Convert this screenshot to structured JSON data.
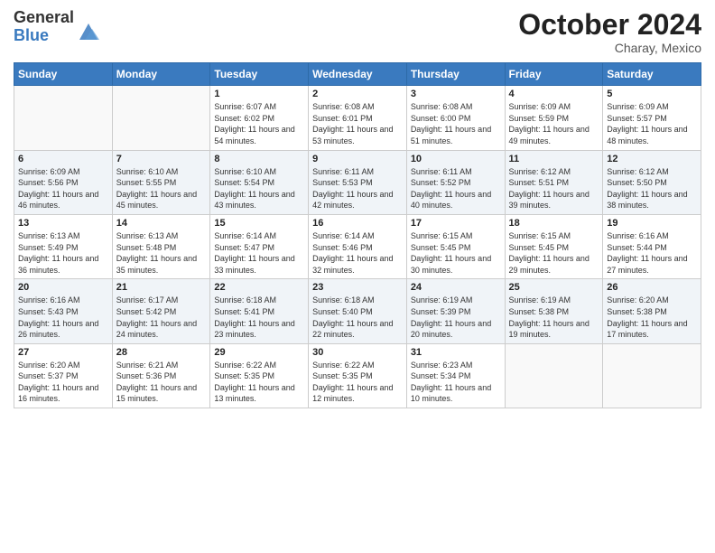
{
  "header": {
    "logo_general": "General",
    "logo_blue": "Blue",
    "month": "October 2024",
    "location": "Charay, Mexico"
  },
  "weekdays": [
    "Sunday",
    "Monday",
    "Tuesday",
    "Wednesday",
    "Thursday",
    "Friday",
    "Saturday"
  ],
  "weeks": [
    [
      {
        "day": "",
        "info": ""
      },
      {
        "day": "",
        "info": ""
      },
      {
        "day": "1",
        "info": "Sunrise: 6:07 AM\nSunset: 6:02 PM\nDaylight: 11 hours and 54 minutes."
      },
      {
        "day": "2",
        "info": "Sunrise: 6:08 AM\nSunset: 6:01 PM\nDaylight: 11 hours and 53 minutes."
      },
      {
        "day": "3",
        "info": "Sunrise: 6:08 AM\nSunset: 6:00 PM\nDaylight: 11 hours and 51 minutes."
      },
      {
        "day": "4",
        "info": "Sunrise: 6:09 AM\nSunset: 5:59 PM\nDaylight: 11 hours and 49 minutes."
      },
      {
        "day": "5",
        "info": "Sunrise: 6:09 AM\nSunset: 5:57 PM\nDaylight: 11 hours and 48 minutes."
      }
    ],
    [
      {
        "day": "6",
        "info": "Sunrise: 6:09 AM\nSunset: 5:56 PM\nDaylight: 11 hours and 46 minutes."
      },
      {
        "day": "7",
        "info": "Sunrise: 6:10 AM\nSunset: 5:55 PM\nDaylight: 11 hours and 45 minutes."
      },
      {
        "day": "8",
        "info": "Sunrise: 6:10 AM\nSunset: 5:54 PM\nDaylight: 11 hours and 43 minutes."
      },
      {
        "day": "9",
        "info": "Sunrise: 6:11 AM\nSunset: 5:53 PM\nDaylight: 11 hours and 42 minutes."
      },
      {
        "day": "10",
        "info": "Sunrise: 6:11 AM\nSunset: 5:52 PM\nDaylight: 11 hours and 40 minutes."
      },
      {
        "day": "11",
        "info": "Sunrise: 6:12 AM\nSunset: 5:51 PM\nDaylight: 11 hours and 39 minutes."
      },
      {
        "day": "12",
        "info": "Sunrise: 6:12 AM\nSunset: 5:50 PM\nDaylight: 11 hours and 38 minutes."
      }
    ],
    [
      {
        "day": "13",
        "info": "Sunrise: 6:13 AM\nSunset: 5:49 PM\nDaylight: 11 hours and 36 minutes."
      },
      {
        "day": "14",
        "info": "Sunrise: 6:13 AM\nSunset: 5:48 PM\nDaylight: 11 hours and 35 minutes."
      },
      {
        "day": "15",
        "info": "Sunrise: 6:14 AM\nSunset: 5:47 PM\nDaylight: 11 hours and 33 minutes."
      },
      {
        "day": "16",
        "info": "Sunrise: 6:14 AM\nSunset: 5:46 PM\nDaylight: 11 hours and 32 minutes."
      },
      {
        "day": "17",
        "info": "Sunrise: 6:15 AM\nSunset: 5:45 PM\nDaylight: 11 hours and 30 minutes."
      },
      {
        "day": "18",
        "info": "Sunrise: 6:15 AM\nSunset: 5:45 PM\nDaylight: 11 hours and 29 minutes."
      },
      {
        "day": "19",
        "info": "Sunrise: 6:16 AM\nSunset: 5:44 PM\nDaylight: 11 hours and 27 minutes."
      }
    ],
    [
      {
        "day": "20",
        "info": "Sunrise: 6:16 AM\nSunset: 5:43 PM\nDaylight: 11 hours and 26 minutes."
      },
      {
        "day": "21",
        "info": "Sunrise: 6:17 AM\nSunset: 5:42 PM\nDaylight: 11 hours and 24 minutes."
      },
      {
        "day": "22",
        "info": "Sunrise: 6:18 AM\nSunset: 5:41 PM\nDaylight: 11 hours and 23 minutes."
      },
      {
        "day": "23",
        "info": "Sunrise: 6:18 AM\nSunset: 5:40 PM\nDaylight: 11 hours and 22 minutes."
      },
      {
        "day": "24",
        "info": "Sunrise: 6:19 AM\nSunset: 5:39 PM\nDaylight: 11 hours and 20 minutes."
      },
      {
        "day": "25",
        "info": "Sunrise: 6:19 AM\nSunset: 5:38 PM\nDaylight: 11 hours and 19 minutes."
      },
      {
        "day": "26",
        "info": "Sunrise: 6:20 AM\nSunset: 5:38 PM\nDaylight: 11 hours and 17 minutes."
      }
    ],
    [
      {
        "day": "27",
        "info": "Sunrise: 6:20 AM\nSunset: 5:37 PM\nDaylight: 11 hours and 16 minutes."
      },
      {
        "day": "28",
        "info": "Sunrise: 6:21 AM\nSunset: 5:36 PM\nDaylight: 11 hours and 15 minutes."
      },
      {
        "day": "29",
        "info": "Sunrise: 6:22 AM\nSunset: 5:35 PM\nDaylight: 11 hours and 13 minutes."
      },
      {
        "day": "30",
        "info": "Sunrise: 6:22 AM\nSunset: 5:35 PM\nDaylight: 11 hours and 12 minutes."
      },
      {
        "day": "31",
        "info": "Sunrise: 6:23 AM\nSunset: 5:34 PM\nDaylight: 11 hours and 10 minutes."
      },
      {
        "day": "",
        "info": ""
      },
      {
        "day": "",
        "info": ""
      }
    ]
  ]
}
